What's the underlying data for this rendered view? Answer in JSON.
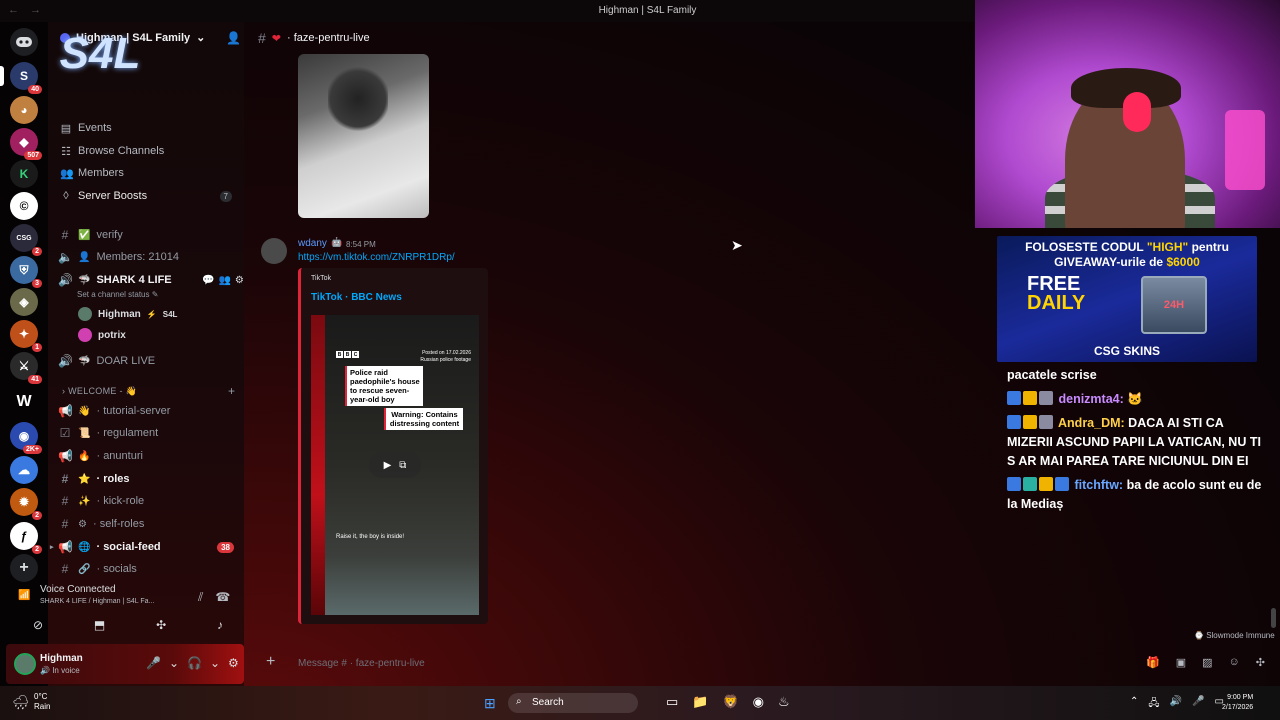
{
  "window": {
    "title": "Highman | S4L Family"
  },
  "rail": {
    "badges": [
      "40",
      "507",
      "2",
      "3",
      "1",
      "41",
      "2K+",
      "2",
      "2"
    ]
  },
  "server": {
    "name": "Highman | S4L Family",
    "banner_text": "S4L",
    "menu": {
      "events": "Events",
      "browse": "Browse Channels",
      "members": "Members",
      "boosts": "Server Boosts",
      "boosts_count": "7"
    }
  },
  "channels": {
    "verify": "verify",
    "members_count": "Members: 21014",
    "voice_shark": "SHARK 4 LIFE",
    "voice_status": "Set a channel status",
    "member1_name": "Highman",
    "member1_tag": "S4L",
    "member2_name": "potrix",
    "doar_live": "DOAR LIVE",
    "category": "WELCOME -",
    "tutorial": "tutorial-server",
    "regulament": "regulament",
    "anunturi": "anunturi",
    "roles": "roles",
    "kick_role": "kick-role",
    "self_roles": "self-roles",
    "social_feed": "social-feed",
    "social_feed_unread": "38",
    "socials": "socials"
  },
  "voice_panel": {
    "title": "Voice Connected",
    "subtitle": "SHARK 4 LIFE / Highman | S4L Fa..."
  },
  "user_panel": {
    "name": "Highman",
    "status": "In voice"
  },
  "header": {
    "channel": "faze-pentru-live"
  },
  "message": {
    "author": "wdany",
    "time": "8:54 PM",
    "link": "https://vm.tiktok.com/ZNRPR1DRp/",
    "embed": {
      "provider": "TikTok",
      "title": "TikTok · BBC News",
      "bbc": [
        "B",
        "B",
        "C"
      ],
      "posted": "Posted on 17.02.2026\nRussian police footage",
      "caption1": "Police raid paedophile's house to rescue seven-year-old boy",
      "caption2": "Warning: Contains distressing content",
      "subtitle": "Raise it, the boy is inside!"
    }
  },
  "slowmode": "Slowmode Immune",
  "composer": {
    "placeholder": "Message #  · faze-pentru-live"
  },
  "stream": {
    "sponsor": {
      "line1_a": "FOLOSESTE CODUL ",
      "line1_b": "\"HIGH\"",
      "line1_c": " pentru",
      "line2_a": "GIVEAWAY-urile de ",
      "line2_b": "$6000",
      "free": "FREE",
      "daily": "DAILY",
      "box": "24H",
      "brand": "CSG SKINS"
    },
    "chat": [
      {
        "user": "",
        "text": "pacatele scrise"
      },
      {
        "user": "denizmta4:",
        "text": ""
      },
      {
        "user": "Andra_DM:",
        "text": "DACA AI STI CA MIZERII ASCUND PAPII LA VATICAN, NU TI S AR MAI PAREA TARE NICIUNUL DIN EI"
      },
      {
        "user": "fitchftw:",
        "text": "ba de acolo sunt eu de la Mediaș"
      }
    ]
  },
  "taskbar": {
    "temp": "0°C",
    "weather": "Rain",
    "search": "Search",
    "time": "9:00 PM",
    "date": "2/17/2026"
  },
  "colors": {
    "accent": "#5865f2",
    "link": "#00a8fc",
    "embed_border": "#e0243a",
    "unread": "#da373c"
  }
}
